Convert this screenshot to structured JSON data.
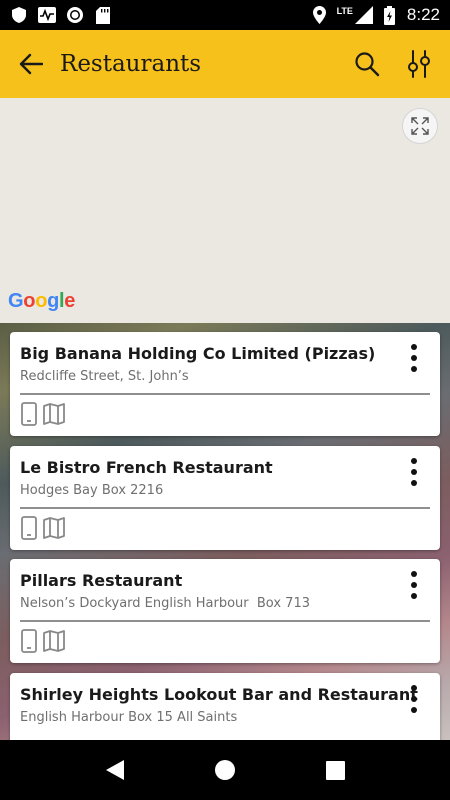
{
  "status_bar": {
    "time": "8:22",
    "network": "LTE"
  },
  "app_bar": {
    "title": "Restaurants",
    "background": "#f7c11b"
  },
  "map": {
    "provider_logo": "Google"
  },
  "restaurants": [
    {
      "name": "Big Banana Holding Co Limited (Pizzas)",
      "address": "Redcliffe Street, St. John’s"
    },
    {
      "name": "Le Bistro French Restaurant",
      "address": "Hodges Bay Box 2216"
    },
    {
      "name": "Pillars Restaurant",
      "address": "Nelson’s Dockyard English Harbour  Box 713"
    },
    {
      "name": "Shirley Heights Lookout Bar and Restaurant",
      "address": "English Harbour Box 15 All Saints"
    }
  ],
  "icons": {
    "phone": "phone-icon",
    "map": "map-icon",
    "more": "more-vert-icon"
  }
}
